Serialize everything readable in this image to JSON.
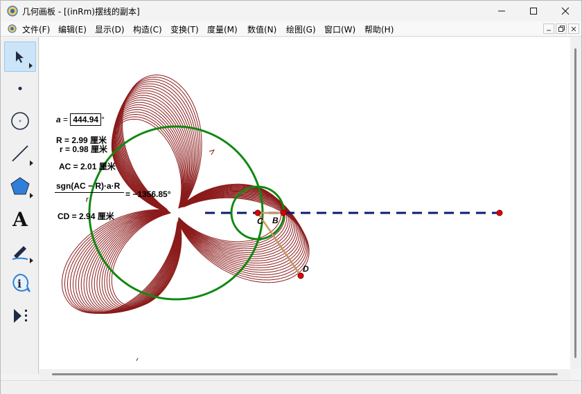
{
  "window": {
    "title": "几何画板 - [(inRm)摆线的副本]"
  },
  "menu": {
    "items": [
      "文件(F)",
      "编辑(E)",
      "显示(D)",
      "构造(C)",
      "变换(T)",
      "度量(M)",
      "数值(N)",
      "绘图(G)",
      "窗口(W)",
      "帮助(H)"
    ]
  },
  "tools": [
    {
      "name": "arrow-tool",
      "icon": "arrow-select-icon"
    },
    {
      "name": "point-tool",
      "icon": "point-icon"
    },
    {
      "name": "compass-tool",
      "icon": "compass-circle-icon"
    },
    {
      "name": "straightedge-tool",
      "icon": "segment-icon"
    },
    {
      "name": "polygon-tool",
      "icon": "polygon-icon"
    },
    {
      "name": "text-tool",
      "icon": "text-a-icon"
    },
    {
      "name": "marker-tool",
      "icon": "marker-pen-icon"
    },
    {
      "name": "info-tool",
      "icon": "information-icon"
    },
    {
      "name": "custom-tool",
      "icon": "custom-tools-icon"
    }
  ],
  "measurements": {
    "a_label": "a",
    "a_value": "444.94",
    "a_unit": "°",
    "R": "R = 2.99 厘米",
    "r": "r = 0.98 厘米",
    "AC": "AC = 2.01 厘米",
    "formula_num": "sgn(AC − R)·a·R",
    "formula_den": "r",
    "formula_result": "= −1356.85°",
    "CD": "CD = 2.94 厘米"
  },
  "points": {
    "C": "C",
    "B": "B",
    "D": "D"
  },
  "colors": {
    "curve": "#8b1a1a",
    "circle": "#118811",
    "dashed_line": "#0b1a6e",
    "point_fill": "#e00000",
    "segment": "#c89660"
  }
}
